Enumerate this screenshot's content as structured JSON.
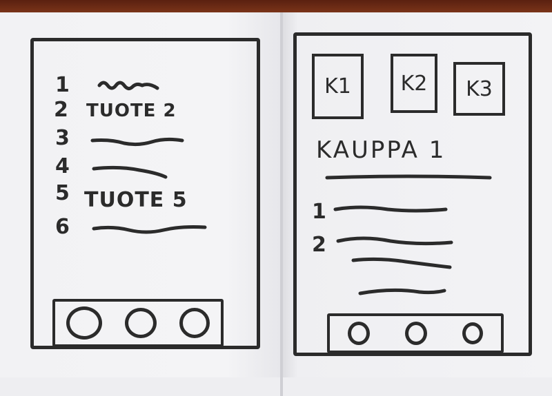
{
  "left_screen": {
    "items": [
      {
        "number": "1",
        "label": ""
      },
      {
        "number": "2",
        "label": "TUOTE 2"
      },
      {
        "number": "3",
        "label": ""
      },
      {
        "number": "4",
        "label": ""
      },
      {
        "number": "5",
        "label": "TUOTE 5"
      },
      {
        "number": "6",
        "label": ""
      }
    ],
    "nav_buttons": 3
  },
  "right_screen": {
    "tabs": [
      "K1",
      "K2",
      "K3"
    ],
    "title": "KAUPPA 1",
    "items": [
      {
        "number": "1"
      },
      {
        "number": "2"
      }
    ],
    "nav_buttons": 3
  },
  "colors": {
    "ink": "#2b2b2b",
    "paper": "#f1f1f3",
    "table": "#6b2a16"
  }
}
